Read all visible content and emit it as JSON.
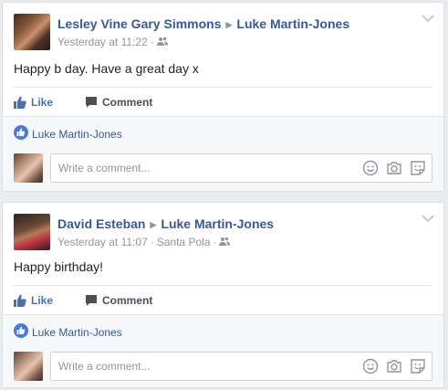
{
  "posts": [
    {
      "author": "Lesley Vine Gary Simmons",
      "recipient": "Luke Martin-Jones",
      "timestamp": "Yesterday at 11:22",
      "location": "",
      "audience_icon": "friends-icon",
      "text": "Happy b day. Have a great day x",
      "like_label": "Like",
      "comment_label": "Comment",
      "liked_by": "Luke Martin-Jones",
      "comment_placeholder": "Write a comment..."
    },
    {
      "author": "David Esteban",
      "recipient": "Luke Martin-Jones",
      "timestamp": "Yesterday at 11:07",
      "location": "Santa Pola",
      "audience_icon": "friends-icon",
      "text": "Happy birthday!",
      "like_label": "Like",
      "comment_label": "Comment",
      "liked_by": "Luke Martin-Jones",
      "comment_placeholder": "Write a comment..."
    }
  ],
  "colors": {
    "link": "#365899",
    "like_blue": "#4b6fb4",
    "meta_gray": "#90949c",
    "background": "#e9ebee"
  }
}
